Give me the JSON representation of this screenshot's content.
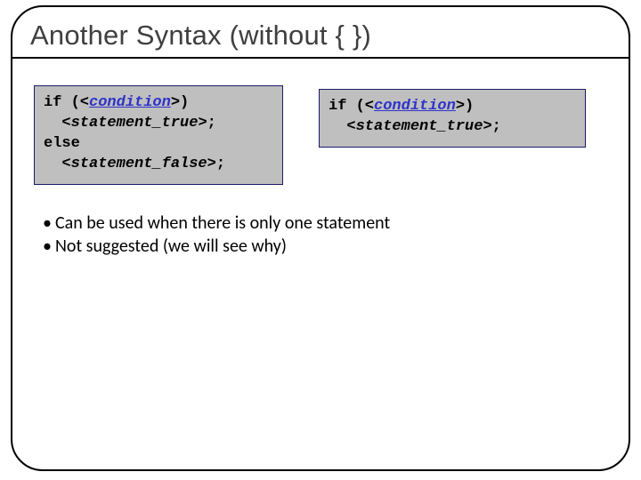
{
  "title": "Another Syntax (without { })",
  "code_left": {
    "l1_prefix": "if (<",
    "l1_cond": "condition",
    "l1_suffix": ">)",
    "l2_indent": "  <",
    "l2_stmt": "statement_true",
    "l2_suffix": ">;",
    "l3": "else",
    "l4_indent": "  <",
    "l4_stmt": "statement_false",
    "l4_suffix": ">;"
  },
  "code_right": {
    "l1_prefix": "if (<",
    "l1_cond": "condition",
    "l1_suffix": ">)",
    "l2_indent": "  <",
    "l2_stmt": "statement_true",
    "l2_suffix": ">;"
  },
  "bullets": [
    "Can be used when there is only one statement",
    "Not suggested (we will see why)"
  ],
  "bullet_glyph": "•"
}
